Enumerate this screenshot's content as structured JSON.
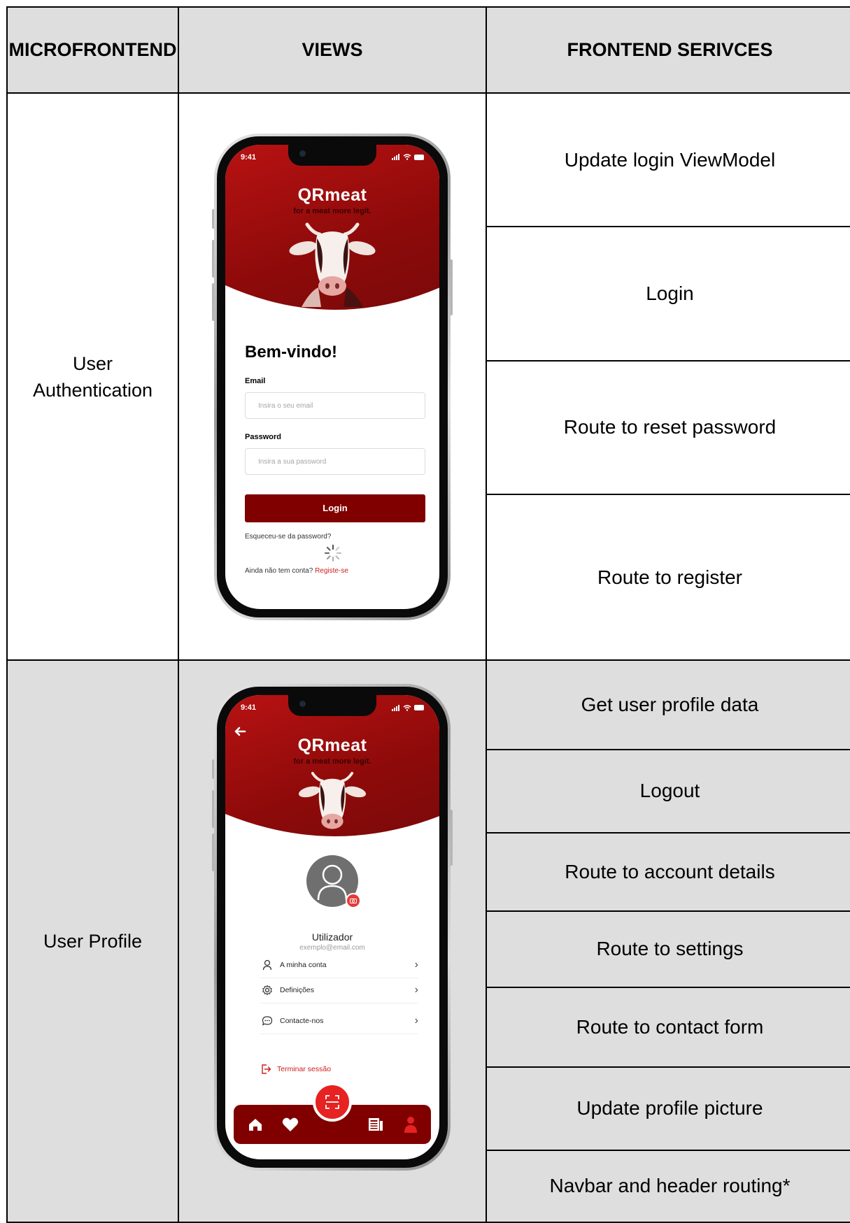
{
  "table": {
    "headers": [
      "MICROFRONTEND",
      "VIEWS",
      "FRONTEND SERIVCES"
    ],
    "sections": [
      {
        "microfrontend": "User Authentication",
        "services": [
          "Update login ViewModel",
          "Login",
          "Route to reset password",
          "Route to register"
        ]
      },
      {
        "microfrontend": "User Profile",
        "services": [
          "Get user profile data",
          "Logout",
          "Route to account details",
          "Route to settings",
          "Route to contact form",
          "Update profile picture",
          "Navbar and header routing*"
        ]
      }
    ]
  },
  "login_screen": {
    "time": "9:41",
    "logo": "QRmeat",
    "tagline": "for a meat more legit.",
    "welcome": "Bem-vindo!",
    "email_label": "Email",
    "email_placeholder": "Insira o seu email",
    "password_label": "Password",
    "password_placeholder": "Insira a sua password",
    "login_button": "Login",
    "forgot_password": "Esqueceu-se da password?",
    "no_account": "Ainda não tem conta?",
    "register_link": "Registe-se"
  },
  "profile_screen": {
    "time": "9:41",
    "logo": "QRmeat",
    "tagline": "for a meat more legit.",
    "user_name": "Utilizador",
    "user_email": "exemplo@email.com",
    "menu": [
      {
        "label": "A minha conta",
        "icon": "user-icon"
      },
      {
        "label": "Definições",
        "icon": "gear-icon"
      },
      {
        "label": "Contacte-nos",
        "icon": "chat-icon"
      }
    ],
    "logout": "Terminar sessão",
    "nav_icons": [
      "home-icon",
      "heart-icon",
      "scan-icon",
      "news-icon",
      "person-icon"
    ]
  },
  "colors": {
    "brand_red": "#8d0a0a",
    "button_red": "#800000",
    "accent_red": "#e62222",
    "gray_cell": "#dedede"
  }
}
